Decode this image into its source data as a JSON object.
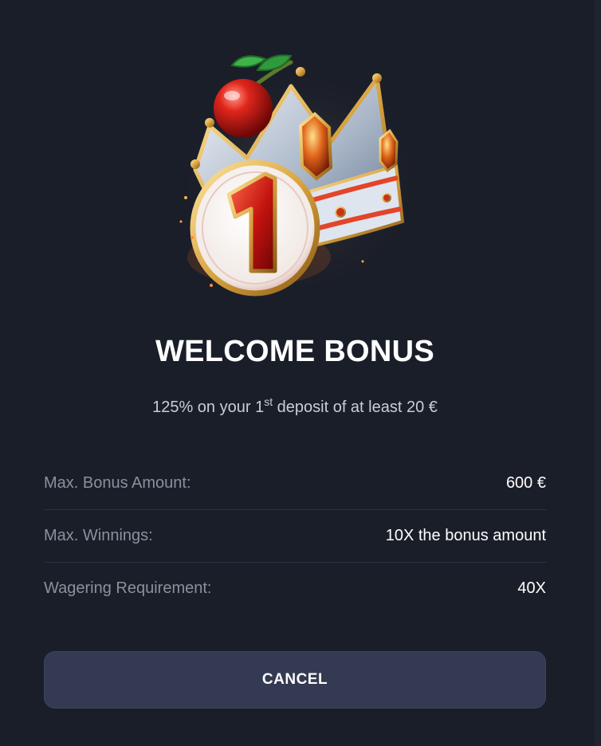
{
  "modal": {
    "title": "WELCOME BONUS",
    "subtitle": {
      "prefix": "125% on your 1",
      "superscript": "st",
      "suffix": " deposit of at least 20 €"
    },
    "hero_icon": "crown-cherry-number-one-illustration",
    "details": [
      {
        "label": "Max. Bonus Amount:",
        "value": "600 €"
      },
      {
        "label": "Max. Winnings:",
        "value": "10X the bonus amount"
      },
      {
        "label": "Wagering Requirement:",
        "value": "40X"
      }
    ],
    "cancel_label": "CANCEL"
  },
  "colors": {
    "background": "#1a1e29",
    "button": "#343a52",
    "label_text": "#8b909c",
    "divider": "#2d3240"
  }
}
